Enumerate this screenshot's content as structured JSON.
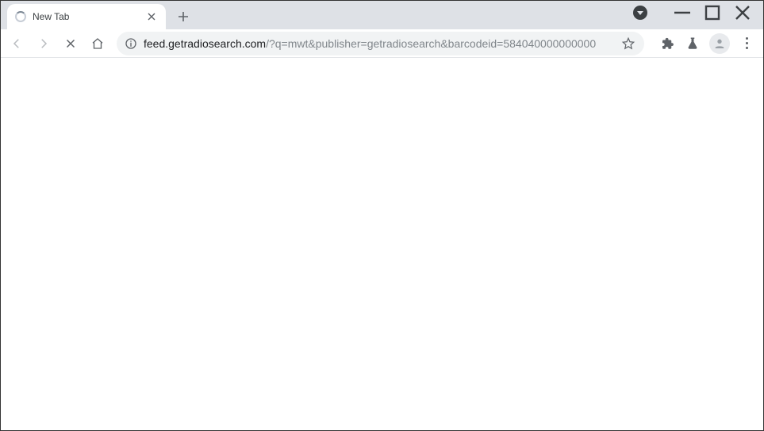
{
  "tab": {
    "title": "New Tab",
    "loading": true
  },
  "url": {
    "host": "feed.getradiosearch.com",
    "path": "/?q=mwt&publisher=getradiosearch&barcodeid=584040000000000"
  },
  "nav": {
    "back_enabled": false,
    "forward_enabled": false
  }
}
